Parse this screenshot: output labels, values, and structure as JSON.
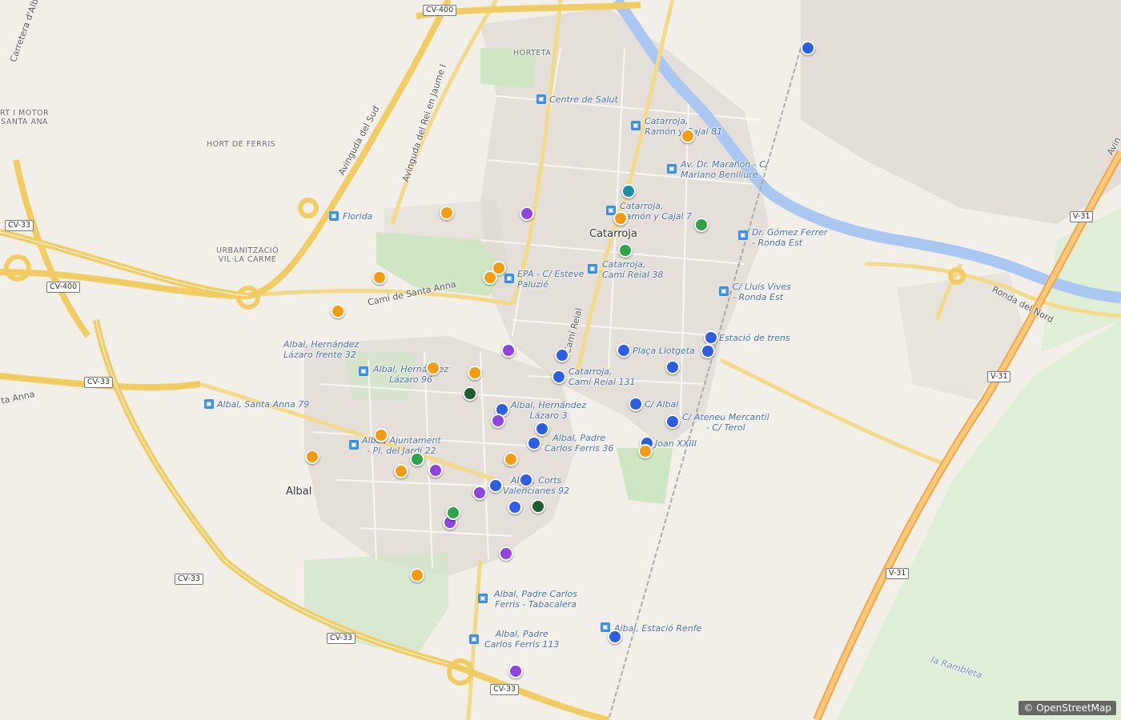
{
  "map": {
    "towns": {
      "catarroja": "Catarroja",
      "albal": "Albal"
    },
    "areas": {
      "horteta": "HORTETA",
      "hort_ferris": "HORT DE FERRIS",
      "hort_motor": "RT I MOTOR\nSANTA ANA",
      "urbanitzacio": "URBANITZACIÓ\nVIL·LA CARME"
    },
    "roads": {
      "carretera_albal": "Carretera d'Albal",
      "avinguda_sud": "Avinguda del Sud",
      "avinguda_rei": "Avinguda del Rei en Jaume I",
      "cami_santa_anna": "Camí de Santa Anna",
      "cami_reial": "Camí Reial",
      "ronda_nord": "Ronda del Nord",
      "la_rambleta": "la Rambleta",
      "anna": "ta Anna",
      "avin_edge": "Avin"
    },
    "shields": {
      "cv400_top": "CV-400",
      "cv400_left": "CV-400",
      "cv33_left": "CV-33",
      "cv33_mid": "CV-33",
      "cv33_bottom": "CV-33",
      "cv33_corner": "CV-33",
      "cv33_south": "CV-33",
      "v31_top": "V-31",
      "v31_mid": "V-31",
      "v31_low": "V-31"
    },
    "stops": {
      "centre_salut": "Centre de Salut",
      "ramon_cajal_81": "Catarroja,\nRamón y Cajal 81",
      "maranon": "Av. Dr. Marañon - C/\nMariano Benlliure",
      "ramon_cajal_7": "Catarroja,\nRamón y Cajal 7",
      "gomez_ferrer": "Dr. Gómez Ferrer\n- Ronda Est",
      "florida": "Florida",
      "cami_reial_38": "Catarroja,\nCamí Reial 38",
      "epa": "EPA - C/ Esteve\nPaluzié",
      "lluis_vives": "C/ Lluís Vives\n- Ronda Est",
      "estacio_trens": "Estació de trens",
      "placa_llotgeta": "Plaça Llotgeta",
      "hernandez_32": "Albal, Hernández\nLázaro frente 32",
      "hernandez_96": "Albal, Hernández\nLázaro 96",
      "cami_reial_131": "Catarroja,\nCamí Reial 131",
      "santa_anna_79": "Albal, Santa Anna 79",
      "c_albal": "C/ Albal",
      "hernandez_3": "Albal, Hernández\nLázaro 3",
      "ateneu": "C/ Ateneu Mercantil\n- C/ Terol",
      "padre_ferris_36": "Albal, Padre\nCarlos Ferris 36",
      "joan_xxiii": "Joan XXIII",
      "ajuntament": "Albal, Ajuntament\n- Pl. del Jardí 22",
      "corts": "Albal, Corts\nValencianes 92",
      "tabacalera": "Albal, Padre Carlos\nFerris - Tabacalera",
      "estacio_renfe": "Albal, Estació Renfe",
      "ferris_113": "Albal, Padre\nCarlos Ferris 113"
    },
    "marker_colors": {
      "blue": "#2e5ee0",
      "orange": "#f39c12",
      "purple": "#8e44dd",
      "green": "#2ea34a",
      "darkgreen": "#1e5e2e",
      "teal": "#1a8fa8"
    },
    "attribution": "© OpenStreetMap"
  }
}
